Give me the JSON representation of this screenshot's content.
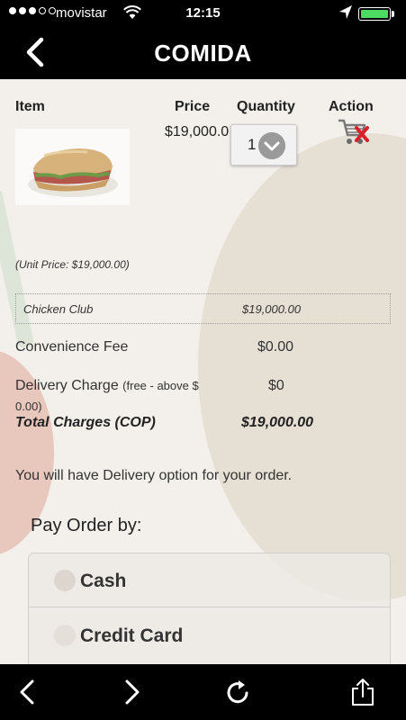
{
  "status_bar": {
    "carrier": "movistar",
    "time": "12:15",
    "signal_bars_filled": 3,
    "signal_bars_total": 5,
    "battery_level": 1.0,
    "battery_color": "#4cd964"
  },
  "nav": {
    "title": "COMIDA",
    "back_icon": "chevron-left-icon"
  },
  "cart": {
    "headers": {
      "item": "Item",
      "price": "Price",
      "quantity": "Quantity",
      "action": "Action"
    },
    "item": {
      "price": "$19,000.0",
      "quantity": "1",
      "unit_price": "(Unit Price: $19,000.00)"
    },
    "line": {
      "name": "Chicken Club",
      "amount": "$19,000.00"
    }
  },
  "charges": {
    "convenience_label": "Convenience Fee",
    "convenience_value": "$0.00",
    "delivery_label": "Delivery Charge",
    "delivery_note_line1": "(free - above $",
    "delivery_note_line2": "0.00)",
    "delivery_value": "$0",
    "total_label": "Total Charges (COP)",
    "total_value": "$19,000.00"
  },
  "delivery_message": "You will have Delivery option for your order.",
  "payment": {
    "title": "Pay Order by:",
    "options": [
      {
        "label": "Cash"
      },
      {
        "label": "Credit Card"
      }
    ]
  },
  "toolbar": {
    "icons": [
      "chevron-left-icon",
      "chevron-right-icon",
      "reload-icon",
      "share-icon"
    ]
  },
  "colors": {
    "bar_background": "#000000",
    "content_background": "#f3f0ec"
  }
}
